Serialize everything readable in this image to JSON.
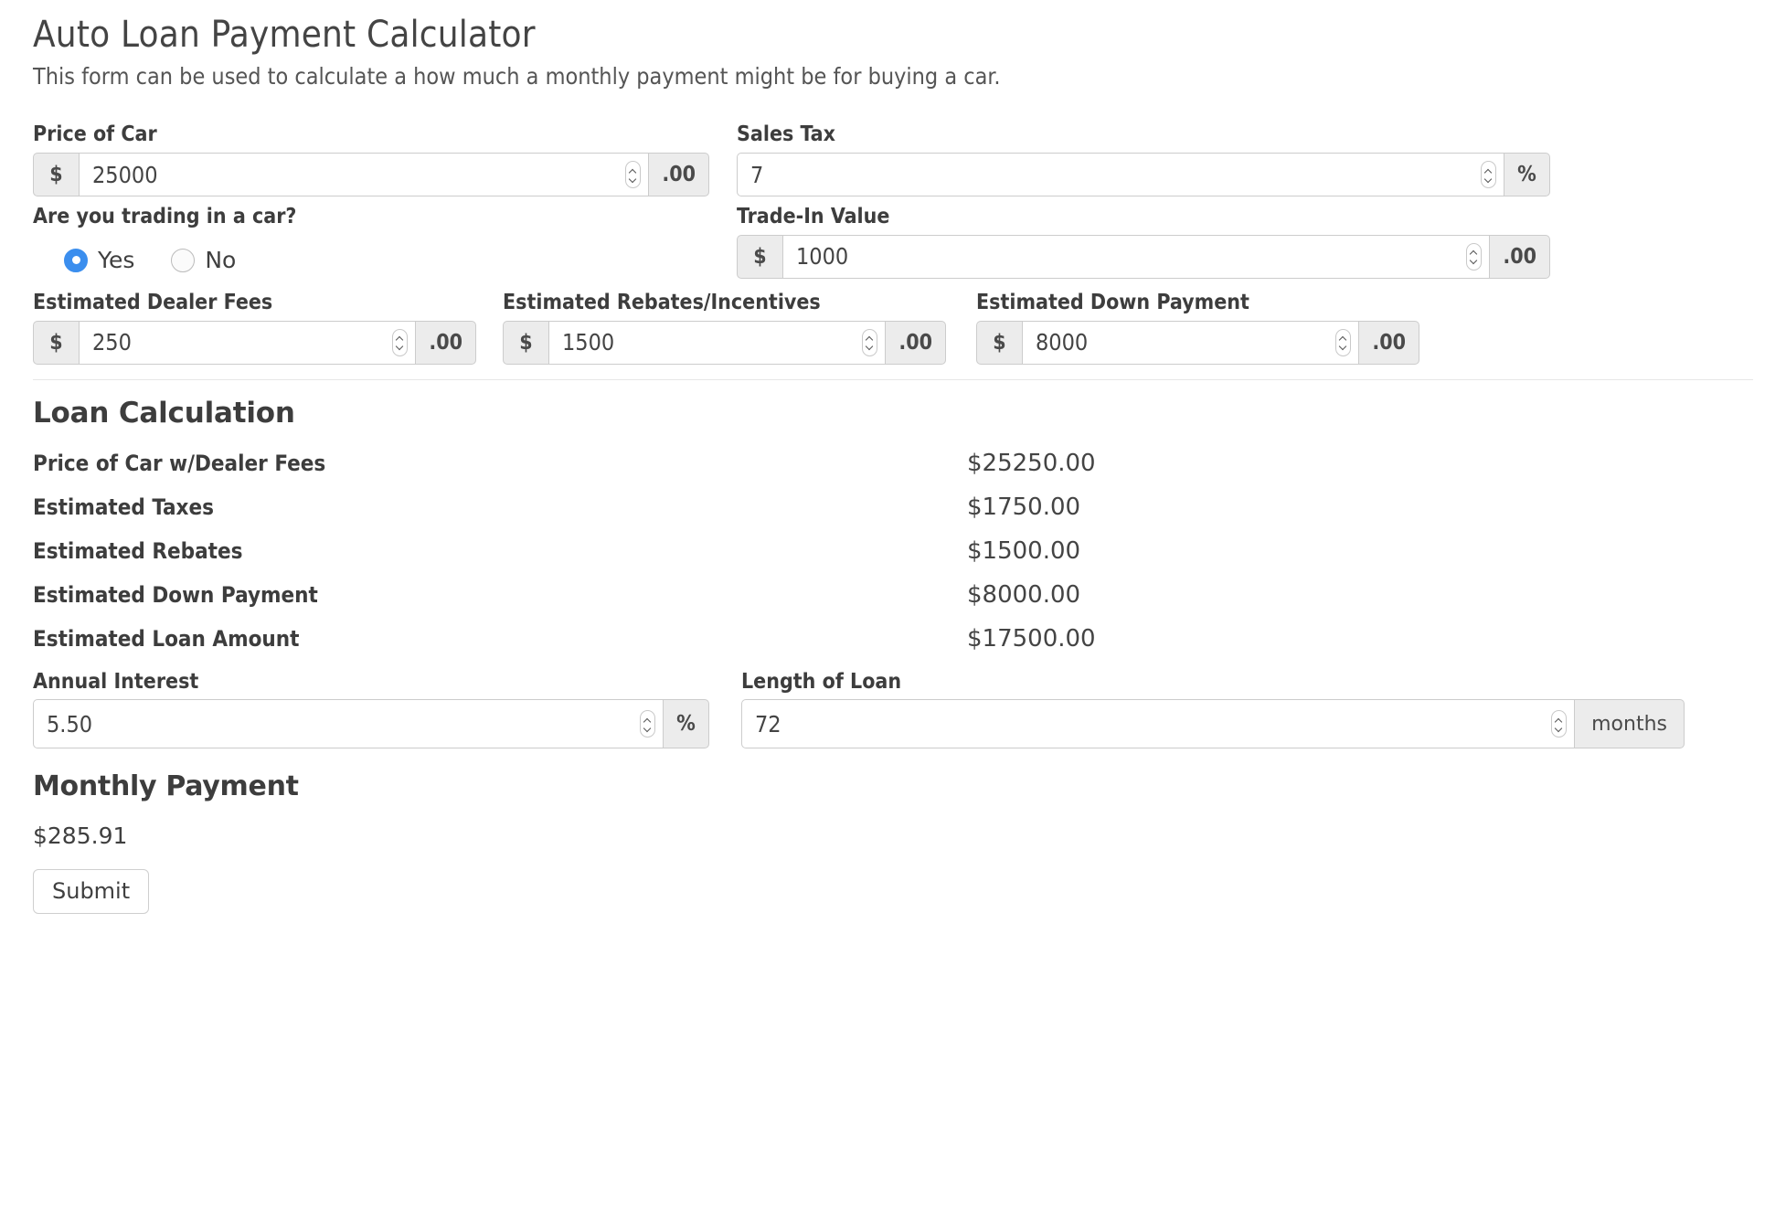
{
  "header": {
    "title": "Auto Loan Payment Calculator",
    "description": "This form can be used to calculate a how much a monthly payment might be for buying a car."
  },
  "form": {
    "price_of_car": {
      "label": "Price of Car",
      "prefix": "$",
      "value": "25000",
      "suffix": ".00"
    },
    "sales_tax": {
      "label": "Sales Tax",
      "value": "7",
      "suffix": "%"
    },
    "trade_in_question": {
      "label": "Are you trading in a car?",
      "options": [
        {
          "label": "Yes",
          "selected": true
        },
        {
          "label": "No",
          "selected": false
        }
      ]
    },
    "trade_in_value": {
      "label": "Trade-In Value",
      "prefix": "$",
      "value": "1000",
      "suffix": ".00"
    },
    "dealer_fees": {
      "label": "Estimated Dealer Fees",
      "prefix": "$",
      "value": "250",
      "suffix": ".00"
    },
    "rebates": {
      "label": "Estimated Rebates/Incentives",
      "prefix": "$",
      "value": "1500",
      "suffix": ".00"
    },
    "down_payment": {
      "label": "Estimated Down Payment",
      "prefix": "$",
      "value": "8000",
      "suffix": ".00"
    },
    "annual_interest": {
      "label": "Annual Interest",
      "value": "5.50",
      "suffix": "%"
    },
    "length_of_loan": {
      "label": "Length of Loan",
      "value": "72",
      "suffix": "months"
    }
  },
  "loan_calculation": {
    "title": "Loan Calculation",
    "rows": [
      {
        "label": "Price of Car w/Dealer Fees",
        "value": "$25250.00"
      },
      {
        "label": "Estimated Taxes",
        "value": "$1750.00"
      },
      {
        "label": "Estimated Rebates",
        "value": "$1500.00"
      },
      {
        "label": "Estimated Down Payment",
        "value": "$8000.00"
      },
      {
        "label": "Estimated Loan Amount",
        "value": "$17500.00"
      }
    ]
  },
  "monthly_payment": {
    "title": "Monthly Payment",
    "value": "$285.91"
  },
  "actions": {
    "submit_label": "Submit"
  },
  "colors": {
    "radio_selected": "#3b8eee",
    "addon_background": "#ececec",
    "border": "#cccccc",
    "text": "#3d3d3d"
  }
}
